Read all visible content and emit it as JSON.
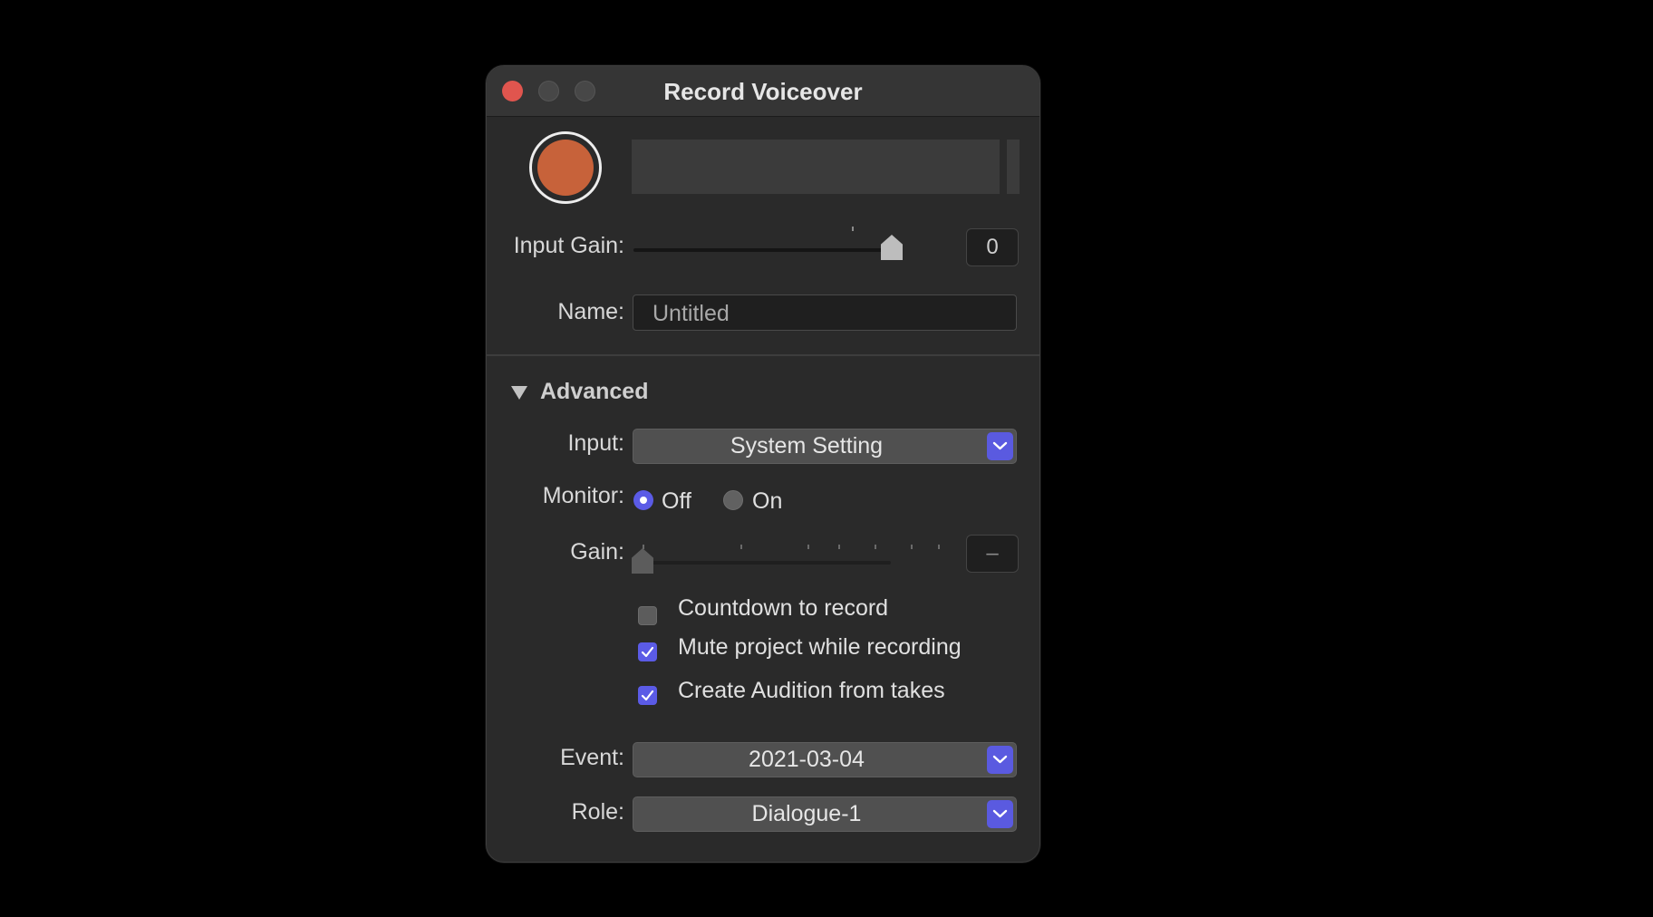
{
  "window": {
    "title": "Record Voiceover"
  },
  "input_gain": {
    "label": "Input Gain:",
    "value": "0",
    "slider_level": 0.95
  },
  "name_field": {
    "label": "Name:",
    "placeholder": "Untitled"
  },
  "advanced": {
    "label": "Advanced",
    "expanded": true,
    "input": {
      "label": "Input:",
      "selected": "System Setting"
    },
    "monitor": {
      "label": "Monitor:",
      "options": [
        "Off",
        "On"
      ],
      "selected": "Off"
    },
    "gain": {
      "label": "Gain:",
      "value": "–",
      "slider_level": 0.0
    },
    "checkboxes": [
      {
        "label": "Countdown to record",
        "checked": false
      },
      {
        "label": "Mute project while recording",
        "checked": true
      },
      {
        "label": "Create Audition from takes",
        "checked": true
      }
    ],
    "event": {
      "label": "Event:",
      "selected": "2021-03-04"
    },
    "role": {
      "label": "Role:",
      "selected": "Dialogue-1"
    }
  },
  "icons": {
    "record": "record-button-icon",
    "disclosure": "disclosure-triangle-icon",
    "popup": "chevron-down-icon",
    "check": "checkmark-icon"
  },
  "colors": {
    "record": "#c7623a",
    "accent": "#5b5be6",
    "close": "#e0554e",
    "window_bg": "#2a2a2a"
  }
}
